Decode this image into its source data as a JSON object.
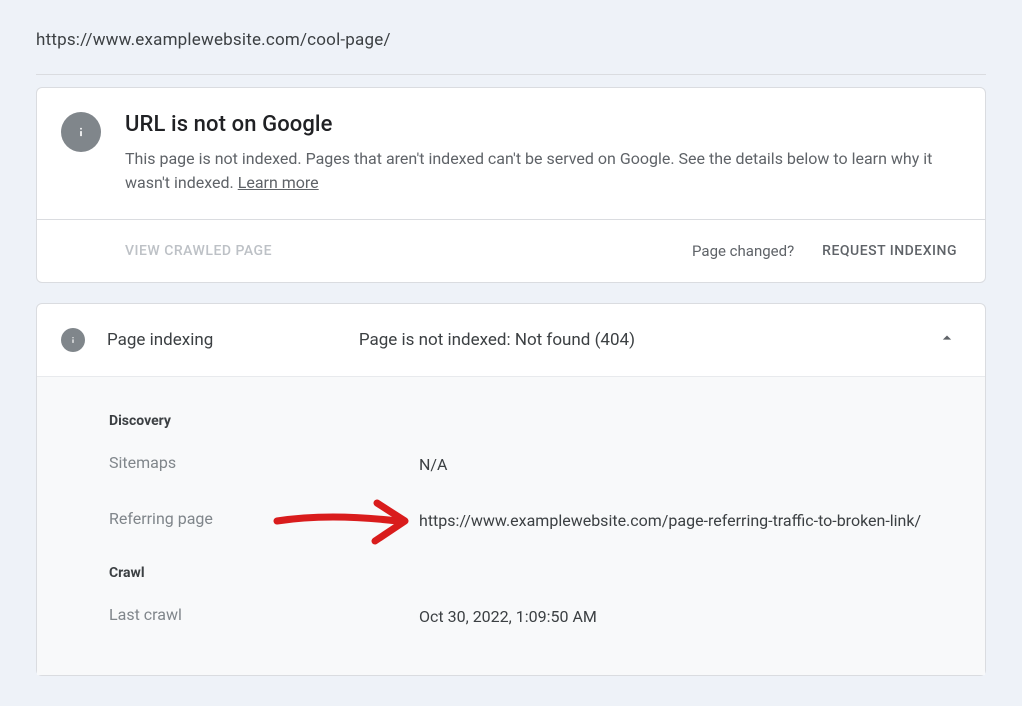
{
  "url": "https://www.examplewebsite.com/cool-page/",
  "status_card": {
    "title": "URL is not on Google",
    "description": "This page is not indexed. Pages that aren't indexed can't be served on Google. See the details below to learn why it wasn't indexed. ",
    "learn_more": "Learn more",
    "view_crawled": "VIEW CRAWLED PAGE",
    "page_changed": "Page changed?",
    "request_indexing": "REQUEST INDEXING"
  },
  "indexing": {
    "section_label": "Page indexing",
    "status": "Page is not indexed: Not found (404)",
    "discovery": {
      "heading": "Discovery",
      "sitemaps_label": "Sitemaps",
      "sitemaps_value": "N/A",
      "referring_label": "Referring page",
      "referring_value": "https://www.examplewebsite.com/page-referring-traffic-to-broken-link/"
    },
    "crawl": {
      "heading": "Crawl",
      "last_crawl_label": "Last crawl",
      "last_crawl_value": "Oct 30, 2022, 1:09:50 AM"
    }
  }
}
